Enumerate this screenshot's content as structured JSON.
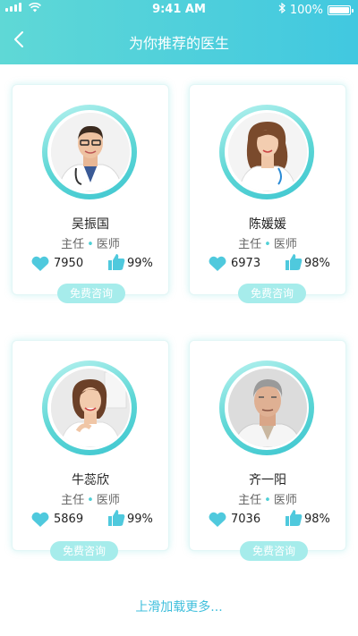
{
  "status_bar": {
    "time": "9:41 AM",
    "battery_percent": "100%"
  },
  "nav": {
    "title": "为你推荐的医生"
  },
  "doctors": [
    {
      "name": "吴振国",
      "role": "主任",
      "sep": "•",
      "dept": "医师",
      "likes": "7950",
      "rating": "99%",
      "consult_label": "免费咨询"
    },
    {
      "name": "陈媛媛",
      "role": "主任",
      "sep": "•",
      "dept": "医师",
      "likes": "6973",
      "rating": "98%",
      "consult_label": "免费咨询"
    },
    {
      "name": "牛蕊欣",
      "role": "主任",
      "sep": "•",
      "dept": "医师",
      "likes": "5869",
      "rating": "99%",
      "consult_label": "免费咨询"
    },
    {
      "name": "齐一阳",
      "role": "主任",
      "sep": "•",
      "dept": "医师",
      "likes": "7036",
      "rating": "98%",
      "consult_label": "免费咨询"
    }
  ],
  "footer": {
    "load_more": "上滑加载更多..."
  },
  "icons": {
    "heart": "heart-icon",
    "thumb": "thumbs-up-icon",
    "back": "chevron-left-icon"
  },
  "colors": {
    "accent": "#41c8e0",
    "heart": "#4fc9dd",
    "consult_bg": "#a6eceb"
  }
}
